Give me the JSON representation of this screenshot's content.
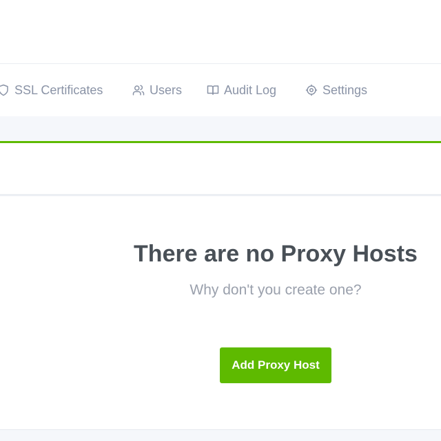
{
  "nav": {
    "items": [
      {
        "label": "SSL Certificates",
        "icon": "shield-icon"
      },
      {
        "label": "Users",
        "icon": "users-icon"
      },
      {
        "label": "Audit Log",
        "icon": "book-icon"
      },
      {
        "label": "Settings",
        "icon": "gear-icon"
      }
    ]
  },
  "empty_state": {
    "title": "There are no Proxy Hosts",
    "subtitle": "Why don't you create one?",
    "button_label": "Add Proxy Host"
  },
  "colors": {
    "accent": "#5eba00",
    "nav_text": "#8a93a6",
    "title_text": "#495057",
    "subtitle_text": "#9aa0ac"
  }
}
